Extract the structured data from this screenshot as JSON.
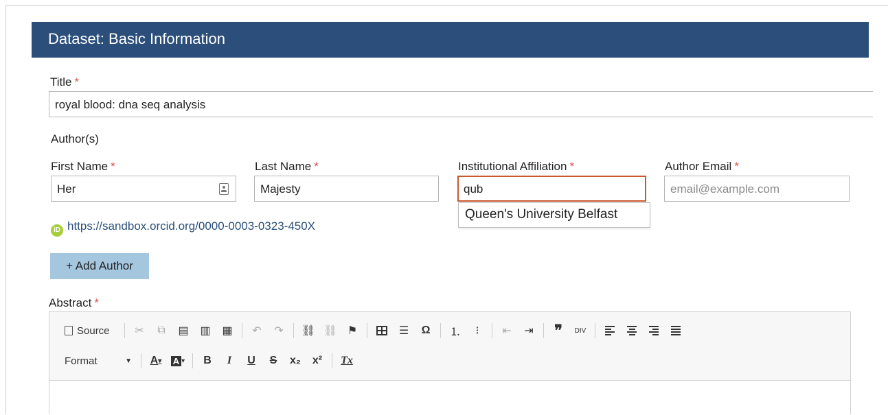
{
  "panel": {
    "title": "Dataset: Basic Information"
  },
  "title_field": {
    "label": "Title",
    "required_mark": "*",
    "value": "royal blood: dna seq analysis"
  },
  "authors": {
    "section_label": "Author(s)",
    "first_name": {
      "label": "First Name",
      "required_mark": "*",
      "value": "Her"
    },
    "last_name": {
      "label": "Last Name",
      "required_mark": "*",
      "value": "Majesty"
    },
    "affiliation": {
      "label": "Institutional Affiliation",
      "required_mark": "*",
      "value": "qub",
      "suggestion": "Queen's University Belfast"
    },
    "email": {
      "label": "Author Email",
      "required_mark": "*",
      "placeholder": "email@example.com"
    },
    "orcid_url": "https://sandbox.orcid.org/0000-0003-0323-450X",
    "add_button": "+ Add Author"
  },
  "abstract": {
    "label": "Abstract",
    "required_mark": "*",
    "toolbar": {
      "source_label": "Source",
      "format_label": "Format",
      "omega": "Ω",
      "bold": "B",
      "italic": "I",
      "underline": "U",
      "strike": "S",
      "subscript": "x₂",
      "superscript": "x²",
      "remove_format": "Tx"
    }
  },
  "colors": {
    "header_bg": "#2b4f7a",
    "required": "#d9534f",
    "active_border": "#c9582e",
    "button_bg": "#a5c6df",
    "orcid": "#a6ce39"
  }
}
